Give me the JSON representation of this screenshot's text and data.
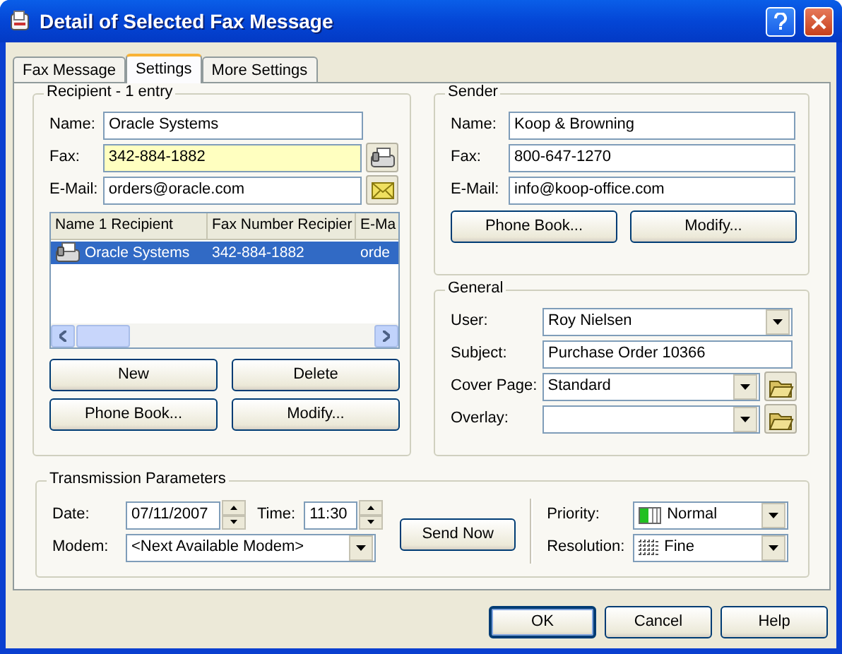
{
  "window": {
    "title": "Detail of Selected Fax Message"
  },
  "tabs": [
    {
      "label": "Fax Message",
      "selected": false
    },
    {
      "label": "Settings",
      "selected": true
    },
    {
      "label": "More Settings",
      "selected": false
    }
  ],
  "recipient": {
    "title": "Recipient - 1 entry",
    "fields": [
      {
        "label": "Name:",
        "value": "Oracle Systems",
        "highlighted": false
      },
      {
        "label": "Fax:",
        "value": "342-884-1882",
        "highlighted": true,
        "kind": "fax"
      },
      {
        "label": "E-Mail:",
        "value": "orders@oracle.com",
        "highlighted": false,
        "kind": "mail"
      }
    ],
    "list": {
      "columns": [
        "Name 1 Recipient",
        "Fax Number Recipier",
        "E-Ma"
      ],
      "rows": [
        {
          "cells": [
            "Oracle Systems",
            "342-884-1882",
            "orde"
          ],
          "selected": true
        }
      ]
    },
    "buttons": [
      "New",
      "Delete",
      "Phone Book...",
      "Modify..."
    ]
  },
  "sender": {
    "title": "Sender",
    "fields": [
      {
        "label": "Name:",
        "value": "Koop & Browning"
      },
      {
        "label": "Fax:",
        "value": "800-647-1270"
      },
      {
        "label": "E-Mail:",
        "value": "info@koop-office.com"
      }
    ],
    "buttons": [
      "Phone Book...",
      "Modify..."
    ]
  },
  "general": {
    "title": "General",
    "fields": [
      {
        "kind": "combo",
        "label": "User:",
        "value": "Roy Nielsen",
        "folder": false
      },
      {
        "kind": "text",
        "label": "Subject:",
        "value": "Purchase Order 10366"
      },
      {
        "kind": "combo",
        "label": "Cover Page:",
        "value": "Standard",
        "folder": true
      },
      {
        "kind": "combo",
        "label": "Overlay:",
        "folder": true
      }
    ]
  },
  "transmission": {
    "title": "Transmission Parameters",
    "date_label": "Date:",
    "date": "07/11/2007",
    "time_label": "Time:",
    "time": "11:30",
    "modem_label": "Modem:",
    "modem": "<Next Available Modem>",
    "send_button": "Send Now",
    "priority_label": "Priority:",
    "priority": "Normal",
    "resolution_label": "Resolution:",
    "resolution": "Fine"
  },
  "buttons": [
    {
      "label": "OK",
      "default": true
    },
    {
      "label": "Cancel",
      "default": false
    },
    {
      "label": "Help",
      "default": false
    }
  ]
}
